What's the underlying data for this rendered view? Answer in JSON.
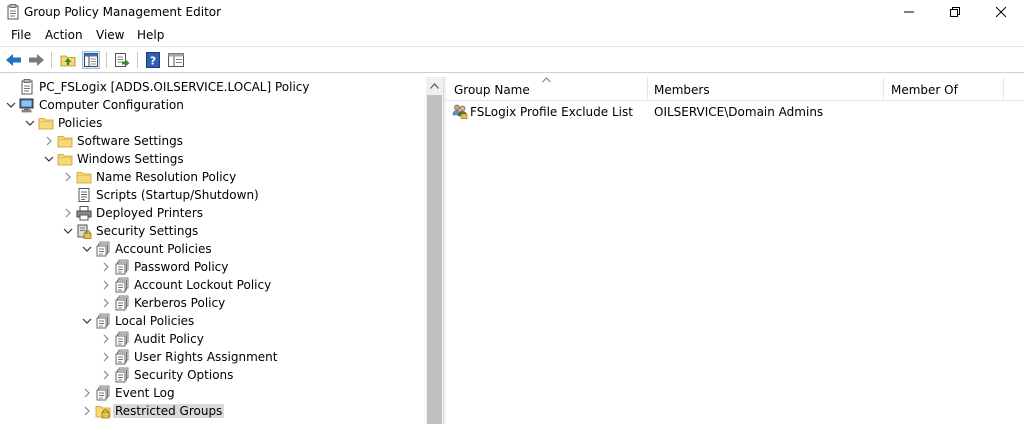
{
  "window": {
    "title": "Group Policy Management Editor"
  },
  "menu": [
    "File",
    "Action",
    "View",
    "Help"
  ],
  "toolbar": {
    "icons": [
      "back-arrow-icon",
      "forward-arrow-icon",
      "up-folder-icon",
      "show-hide-tree-icon",
      "export-list-icon",
      "help-icon",
      "properties-icon"
    ]
  },
  "tree": {
    "items": [
      {
        "label": "PC_FSLogix [ADDS.OILSERVICE.LOCAL] Policy",
        "icon": "policy-document-icon",
        "expander": "none"
      },
      {
        "label": "Computer Configuration",
        "icon": "computer-icon",
        "expander": "expanded"
      },
      {
        "label": "Policies",
        "icon": "folder-icon",
        "expander": "expanded"
      },
      {
        "label": "Software Settings",
        "icon": "folder-icon",
        "expander": "collapsed"
      },
      {
        "label": "Windows Settings",
        "icon": "folder-icon",
        "expander": "expanded"
      },
      {
        "label": "Name Resolution Policy",
        "icon": "folder-icon",
        "expander": "collapsed"
      },
      {
        "label": "Scripts (Startup/Shutdown)",
        "icon": "script-icon",
        "expander": "none"
      },
      {
        "label": "Deployed Printers",
        "icon": "printer-icon",
        "expander": "collapsed"
      },
      {
        "label": "Security Settings",
        "icon": "security-settings-icon",
        "expander": "expanded"
      },
      {
        "label": "Account Policies",
        "icon": "policy-stack-icon",
        "expander": "expanded"
      },
      {
        "label": "Password Policy",
        "icon": "policy-stack-icon",
        "expander": "collapsed"
      },
      {
        "label": "Account Lockout Policy",
        "icon": "policy-stack-icon",
        "expander": "collapsed"
      },
      {
        "label": "Kerberos Policy",
        "icon": "policy-stack-icon",
        "expander": "collapsed"
      },
      {
        "label": "Local Policies",
        "icon": "policy-stack-icon",
        "expander": "expanded"
      },
      {
        "label": "Audit Policy",
        "icon": "policy-stack-icon",
        "expander": "collapsed"
      },
      {
        "label": "User Rights Assignment",
        "icon": "policy-stack-icon",
        "expander": "collapsed"
      },
      {
        "label": "Security Options",
        "icon": "policy-stack-icon",
        "expander": "collapsed"
      },
      {
        "label": "Event Log",
        "icon": "policy-stack-icon",
        "expander": "collapsed"
      },
      {
        "label": "Restricted Groups",
        "icon": "restricted-groups-folder-icon",
        "expander": "collapsed",
        "selected": true
      }
    ]
  },
  "list": {
    "columns": [
      "Group Name",
      "Members",
      "Member Of"
    ],
    "sorted_column": "Group Name",
    "rows": [
      {
        "group_name": "FSLogix Profile Exclude List",
        "members": "OILSERVICE\\Domain Admins",
        "member_of": ""
      }
    ]
  },
  "colors": {
    "selection": "#d9d9d9",
    "folder": "#f8d775",
    "back_arrow": "#1e73be"
  }
}
